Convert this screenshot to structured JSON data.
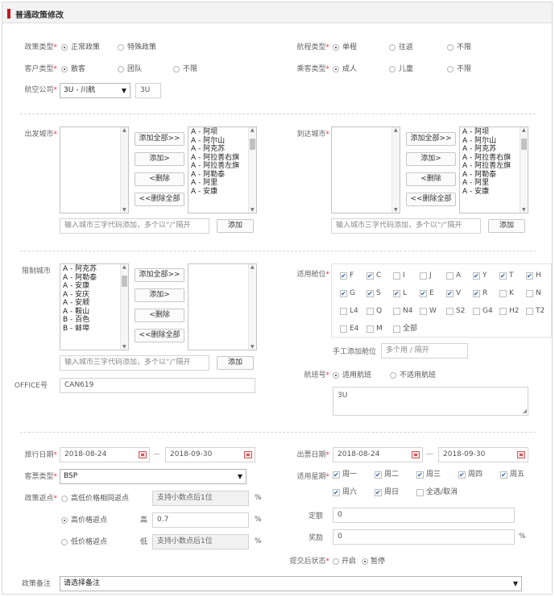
{
  "header": {
    "title": "普通政策修改"
  },
  "req": "*",
  "policy_type": {
    "label": "政策类型",
    "options": [
      "正常政策",
      "特殊政策"
    ]
  },
  "route_type": {
    "label": "航程类型",
    "options": [
      "单程",
      "往返",
      "不限"
    ]
  },
  "customer_type": {
    "label": "客户类型",
    "options": [
      "散客",
      "团队",
      "不限"
    ]
  },
  "passenger_type": {
    "label": "乘客类型",
    "options": [
      "成人",
      "儿童",
      "不限"
    ]
  },
  "airline": {
    "label": "航空公司",
    "value": "3U - 川航",
    "code": "3U"
  },
  "departure": {
    "label": "出发城市",
    "items": [
      "A - 阿坝",
      "A - 阿尔山",
      "A - 阿克苏",
      "A - 阿拉善右旗",
      "A - 阿拉善左旗",
      "A - 阿勒泰",
      "A - 阿里",
      "A - 安康"
    ],
    "placeholder": "输入城市三字代码添加，多个以“/”隔开",
    "add": "添加"
  },
  "arrival": {
    "label": "到达城市",
    "items": [
      "A - 阿坝",
      "A - 阿尔山",
      "A - 阿克苏",
      "A - 阿拉善右旗",
      "A - 阿拉善左旗",
      "A - 阿勒泰",
      "A - 阿里",
      "A - 安康"
    ],
    "placeholder": "输入城市三字代码添加，多个以“/”隔开",
    "add": "添加"
  },
  "restricted": {
    "label": "限制城市",
    "items": [
      "A - 阿克苏",
      "A - 阿勒泰",
      "A - 安康",
      "A - 安庆",
      "A - 安顺",
      "A - 鞍山",
      "B - 百色",
      "B - 蚌埠"
    ],
    "placeholder": "输入城市三字代码添加，多个以“/”隔开",
    "add": "添加"
  },
  "transfer": {
    "add_all": "添加全部>>",
    "add": "添加>",
    "remove": "<删除",
    "remove_all": "<<删除全部"
  },
  "cabin": {
    "label": "适用舱位",
    "manual_label": "手工添加舱位",
    "manual_placeholder": "多个用 / 隔开",
    "rows": [
      [
        {
          "n": "F",
          "on": true
        },
        {
          "n": "C",
          "on": true
        },
        {
          "n": "I",
          "on": false
        },
        {
          "n": "J",
          "on": false
        },
        {
          "n": "A",
          "on": false
        },
        {
          "n": "Y",
          "on": true
        },
        {
          "n": "T",
          "on": true
        },
        {
          "n": "H",
          "on": true
        }
      ],
      [
        {
          "n": "G",
          "on": true
        },
        {
          "n": "S",
          "on": true
        },
        {
          "n": "L",
          "on": true
        },
        {
          "n": "E",
          "on": true
        },
        {
          "n": "V",
          "on": true
        },
        {
          "n": "R",
          "on": true
        },
        {
          "n": "K",
          "on": false
        },
        {
          "n": "N",
          "on": false
        }
      ],
      [
        {
          "n": "L4",
          "on": false
        },
        {
          "n": "Q",
          "on": false
        },
        {
          "n": "N4",
          "on": false
        },
        {
          "n": "W",
          "on": false
        },
        {
          "n": "S2",
          "on": false
        },
        {
          "n": "G4",
          "on": false
        },
        {
          "n": "H2",
          "on": false
        },
        {
          "n": "T2",
          "on": false
        }
      ],
      [
        {
          "n": "E4",
          "on": false
        },
        {
          "n": "M",
          "on": false
        },
        {
          "n": "全部",
          "on": false
        }
      ]
    ]
  },
  "office": {
    "label": "OFFICE号",
    "value": "CAN619"
  },
  "flight": {
    "label": "航班号",
    "options": [
      "适用航班",
      "不适用航班"
    ],
    "value": "3U"
  },
  "travel_date": {
    "label": "旅行日期",
    "from": "2018-08-24",
    "to": "2018-09-30",
    "sep": "—"
  },
  "ticket_date": {
    "label": "出票日期",
    "from": "2018-08-24",
    "to": "2018-09-30",
    "sep": "—"
  },
  "ticket_type": {
    "label": "客票类型",
    "value": "BSP"
  },
  "weekday": {
    "label": "适用星期",
    "days": [
      {
        "n": "周一",
        "on": true
      },
      {
        "n": "周二",
        "on": true
      },
      {
        "n": "周三",
        "on": true
      },
      {
        "n": "周四",
        "on": true
      },
      {
        "n": "周五",
        "on": true
      },
      {
        "n": "周六",
        "on": true
      },
      {
        "n": "周日",
        "on": true
      }
    ],
    "toggle_all": "全选/取消"
  },
  "rebate": {
    "label": "政策返点",
    "opt1": "高低价格相同返点",
    "opt2": "高价格返点",
    "opt3": "低价格返点",
    "high": "高",
    "low": "低",
    "ph": "支持小数点后1位",
    "high_value": "0.7",
    "pct": "%"
  },
  "fixed": {
    "label": "定额",
    "value": "0"
  },
  "reward": {
    "label": "奖励",
    "value": "0",
    "pct": "%"
  },
  "submit_status": {
    "label": "提交后状态",
    "options": [
      "开启",
      "暂停"
    ]
  },
  "remark": {
    "label": "政策备注",
    "value": "请选择备注"
  }
}
